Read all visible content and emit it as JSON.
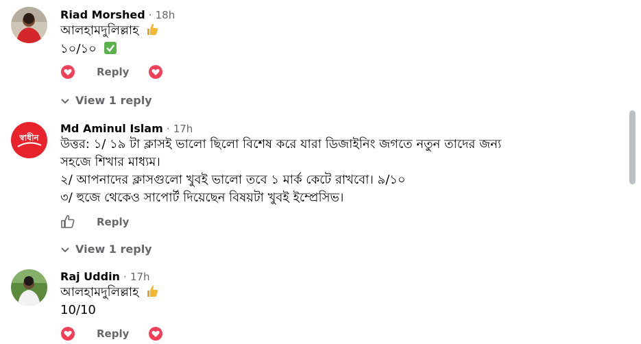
{
  "comments": [
    {
      "author": "Riad Morshed",
      "time": "18h",
      "lines": [
        "আলহামদুলিল্লাহ",
        "১০/১০"
      ],
      "reply_label": "Reply",
      "view_replies": "View 1 reply",
      "emojis": [
        "thumbs-up",
        "check-mark"
      ],
      "reaction": "love"
    },
    {
      "author": "Md Aminul Islam",
      "time": "17h",
      "avatar_text": "স্বাধীন",
      "lines": [
        "উত্তর: ১/ ১৯ টা ক্লাসই ভালো ছিলো বিশেষ করে যারা ডিজাইনিং জগতে নতুন তাদের জন্য",
        "সহজে শিখার মাধ্যম।",
        "২/ আপনাদের ক্লাসগুলো খুবই ভালো তবে ১ মার্ক কেটে রাখবো। ৯/১০",
        "৩/ হুজে থেকেও সাপোর্ট দিয়েছেন বিষয়টা খুবই ইম্প্রেসিভ।"
      ],
      "reply_label": "Reply",
      "view_replies": "View 1 reply",
      "reaction": "like"
    },
    {
      "author": "Raj Uddin",
      "time": "17h",
      "lines": [
        "আলহামদুলিল্লাহ",
        "10/10"
      ],
      "reply_label": "Reply",
      "emojis": [
        "thumbs-up"
      ],
      "reaction": "love"
    }
  ],
  "separator": "·",
  "colors": {
    "meta": "#65676b",
    "love": "#f33e58",
    "avatar_red": "#e8232b",
    "check_green": "#5ab24a",
    "thumb_yellow": "#f5b730"
  }
}
